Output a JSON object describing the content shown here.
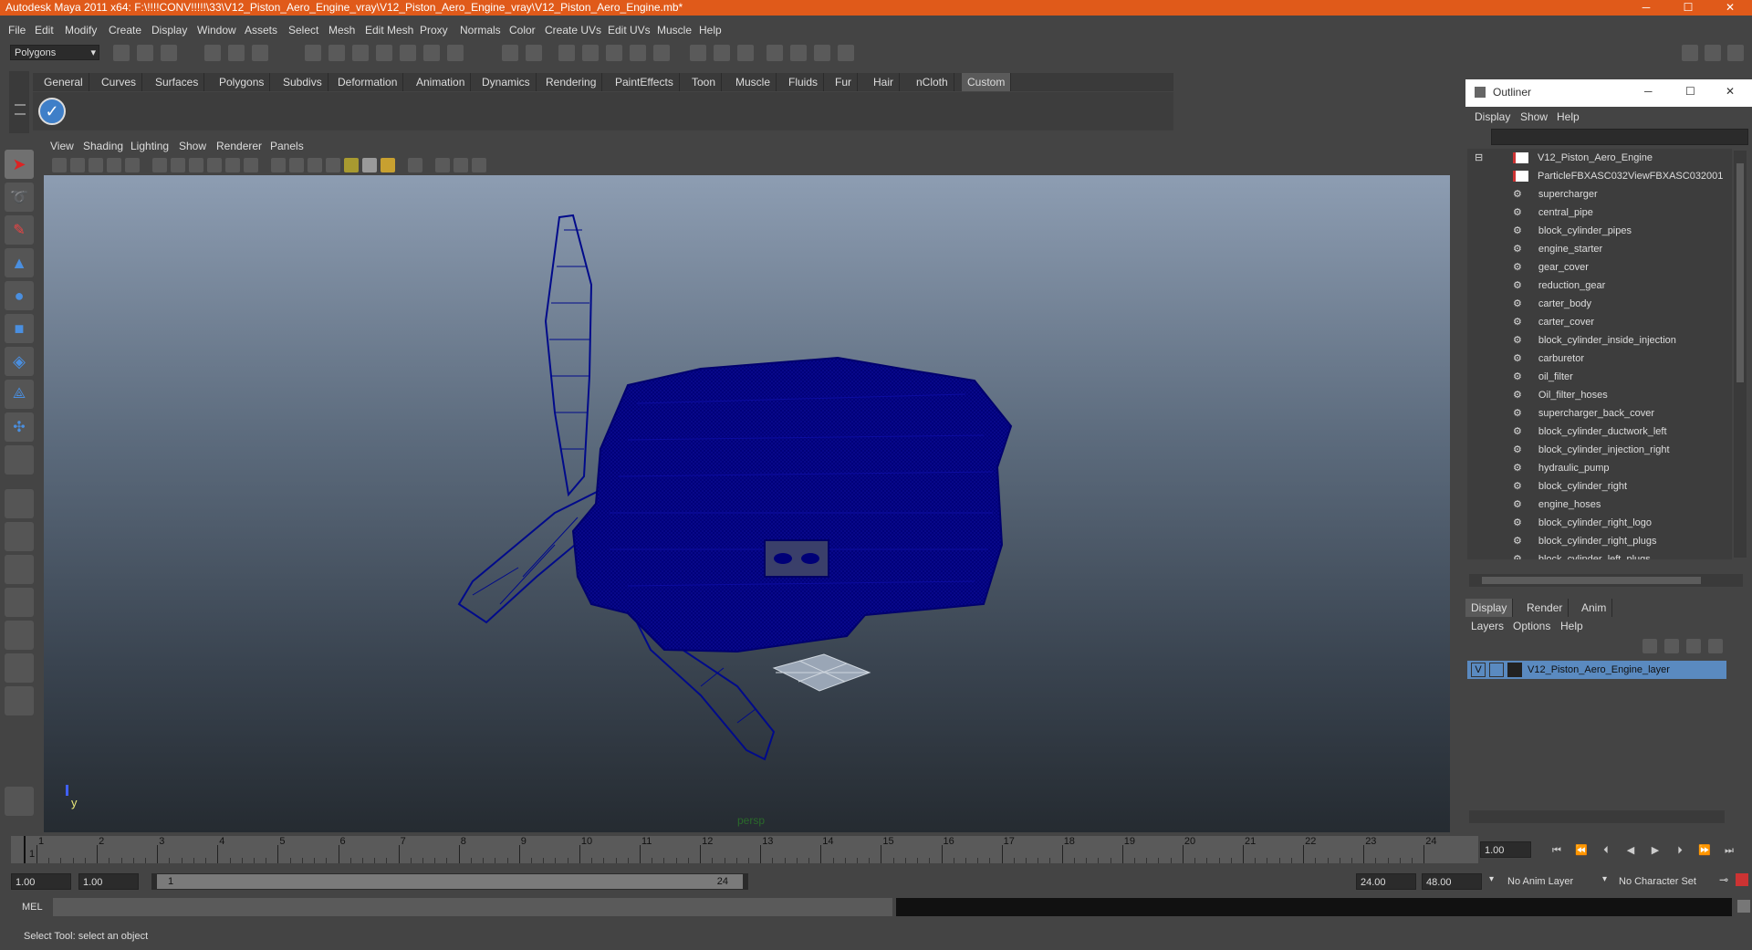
{
  "window": {
    "title": "Autodesk Maya 2011 x64: F:\\!!!!CONV!!!!!\\33\\V12_Piston_Aero_Engine_vray\\V12_Piston_Aero_Engine_vray\\V12_Piston_Aero_Engine.mb*",
    "btn_min": "─",
    "btn_max": "☐",
    "btn_close": "✕"
  },
  "menubar": [
    "File",
    "Edit",
    "Modify",
    "Create",
    "Display",
    "Window",
    "Assets",
    "Select",
    "Mesh",
    "Edit Mesh",
    "Proxy",
    "Normals",
    "Color",
    "Create UVs",
    "Edit UVs",
    "Muscle",
    "Help"
  ],
  "toolbar": {
    "mode": "Polygons"
  },
  "shelf": {
    "tabs": [
      "General",
      "Curves",
      "Surfaces",
      "Polygons",
      "Subdivs",
      "Deformation",
      "Animation",
      "Dynamics",
      "Rendering",
      "PaintEffects",
      "Toon",
      "Muscle",
      "Fluids",
      "Fur",
      "Hair",
      "nCloth",
      "Custom"
    ],
    "active_tab": "Custom"
  },
  "viewport": {
    "menu": [
      "View",
      "Shading",
      "Lighting",
      "Show",
      "Renderer",
      "Panels"
    ],
    "camera_label": "persp",
    "axis_y": "y",
    "wire_color": "#00007a"
  },
  "outliner": {
    "title": "Outliner",
    "menu": [
      "Display",
      "Show",
      "Help"
    ],
    "items": [
      "V12_Piston_Aero_Engine",
      "ParticleFBXASC032ViewFBXASC032001",
      "supercharger",
      "central_pipe",
      "block_cylinder_pipes",
      "engine_starter",
      "gear_cover",
      "reduction_gear",
      "carter_body",
      "carter_cover",
      "block_cylinder_inside_injection",
      "carburetor",
      "oil_filter",
      "Oil_filter_hoses",
      "supercharger_back_cover",
      "block_cylinder_ductwork_left",
      "block_cylinder_injection_right",
      "hydraulic_pump",
      "block_cylinder_right",
      "engine_hoses",
      "block_cylinder_right_logo",
      "block_cylinder_right_plugs",
      "block_cylinder_left_plugs"
    ]
  },
  "layers": {
    "tabs": [
      "Display",
      "Render",
      "Anim"
    ],
    "active_tab": "Display",
    "menu": [
      "Layers",
      "Options",
      "Help"
    ],
    "layer": {
      "v": "V",
      "name": "V12_Piston_Aero_Engine_layer"
    }
  },
  "timeline": {
    "ticks": [
      "1",
      "2",
      "3",
      "4",
      "5",
      "6",
      "7",
      "8",
      "9",
      "10",
      "11",
      "12",
      "13",
      "14",
      "15",
      "16",
      "17",
      "18",
      "19",
      "20",
      "21",
      "22",
      "23",
      "24"
    ],
    "current_frame_field": "1.00",
    "current_marker": "1"
  },
  "range": {
    "start": "1.00",
    "playback_start": "1.00",
    "slider_start": "1",
    "slider_end": "24",
    "playback_end": "24.00",
    "end": "48.00",
    "anim_layer": "No Anim Layer",
    "char_set": "No Character Set"
  },
  "cmdline": {
    "label": "MEL"
  },
  "helpline": {
    "text": "Select Tool: select an object"
  }
}
